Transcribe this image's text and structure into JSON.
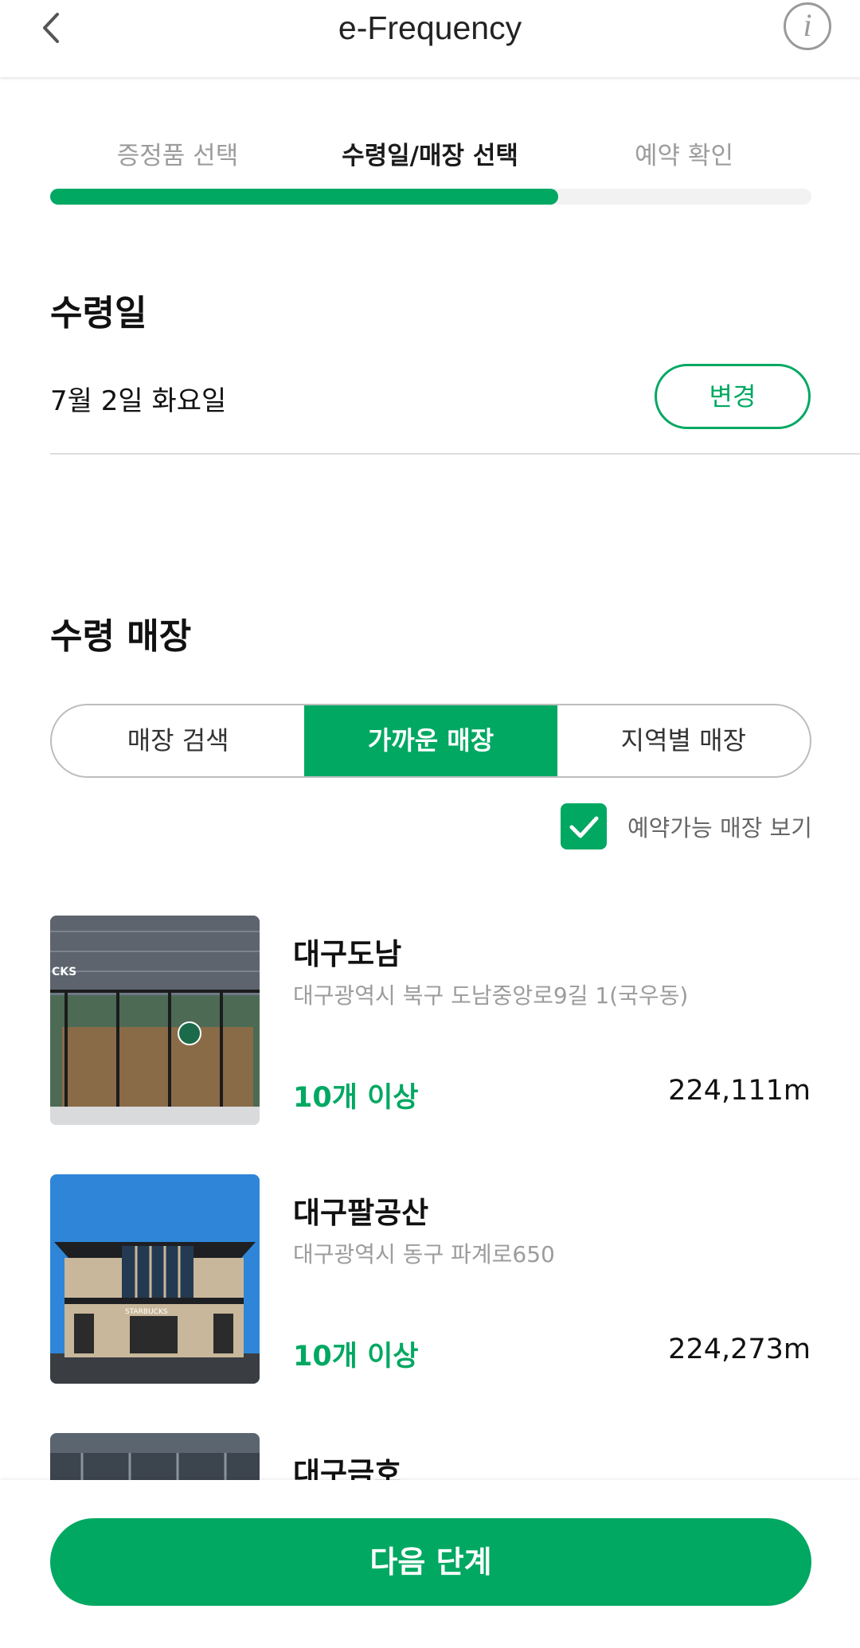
{
  "header": {
    "title": "e-Frequency",
    "back_icon": "chevron-left-icon",
    "info_icon": "info-icon"
  },
  "steps": [
    {
      "label": "증정품 선택"
    },
    {
      "label": "수령일/매장 선택"
    },
    {
      "label": "예약 확인"
    }
  ],
  "progress": {
    "value": 0.667
  },
  "pickup_date": {
    "title": "수령일",
    "value": "7월 2일 화요일",
    "change_label": "변경"
  },
  "pickup_store": {
    "title": "수령 매장",
    "tabs": [
      {
        "label": "매장 검색"
      },
      {
        "label": "가까운 매장"
      },
      {
        "label": "지역별 매장"
      }
    ],
    "selected_tab": "가까운 매장",
    "filter": {
      "label": "예약가능 매장 보기",
      "checked": true
    }
  },
  "stores": [
    {
      "name": "대구도남",
      "address": "대구광역시 북구 도남중앙로9길 1(국우동)",
      "qty": "10개 이상",
      "distance": "224,111m"
    },
    {
      "name": "대구팔공산",
      "address": "대구광역시 동구 파계로650",
      "qty": "10개 이상",
      "distance": "224,273m"
    },
    {
      "name": "대구금호"
    }
  ],
  "footer": {
    "next_label": "다음 단계"
  },
  "colors": {
    "accent": "#00a862",
    "muted": "#9c9c9c"
  }
}
